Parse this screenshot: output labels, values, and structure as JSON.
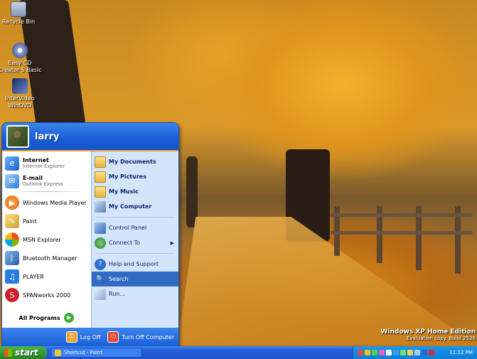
{
  "desktop": {
    "icons": [
      {
        "label": "Recycle Bin",
        "icon": "recycle-bin-icon"
      },
      {
        "label": "Easy CD Creator 5 Basic",
        "icon": "cd-icon"
      },
      {
        "label": "InterVideo WinDVD",
        "icon": "dvd-icon"
      }
    ],
    "watermark": {
      "line1": "Windows XP Home Edition",
      "line2": "Evaluation copy. Build 2526"
    }
  },
  "start_menu": {
    "user_name": "larry",
    "pinned": [
      {
        "title": "Internet",
        "subtitle": "Internet Explorer",
        "icon": "internet-explorer-icon"
      },
      {
        "title": "E-mail",
        "subtitle": "Outlook Express",
        "icon": "outlook-express-icon"
      }
    ],
    "recent": [
      {
        "label": "Windows Media Player",
        "icon": "media-player-icon"
      },
      {
        "label": "Paint",
        "icon": "paint-icon"
      },
      {
        "label": "MSN Explorer",
        "icon": "msn-icon"
      },
      {
        "label": "Bluetooth Manager",
        "icon": "bluetooth-icon"
      },
      {
        "label": "PLAYER",
        "icon": "music-note-icon"
      },
      {
        "label": "SPANworks 2000",
        "icon": "spanworks-icon"
      }
    ],
    "all_programs": "All Programs",
    "right": [
      {
        "label": "My Documents",
        "icon": "folder-icon"
      },
      {
        "label": "My Pictures",
        "icon": "folder-icon"
      },
      {
        "label": "My Music",
        "icon": "folder-icon"
      },
      {
        "label": "My Computer",
        "icon": "computer-icon"
      },
      {
        "label": "Control Panel",
        "icon": "control-panel-icon"
      },
      {
        "label": "Connect To",
        "icon": "connect-icon"
      },
      {
        "label": "Help and Support",
        "icon": "help-icon"
      },
      {
        "label": "Search",
        "icon": "search-icon"
      },
      {
        "label": "Run...",
        "icon": "run-icon"
      }
    ],
    "footer": {
      "log_off": "Log Off",
      "turn_off": "Turn Off Computer"
    }
  },
  "taskbar": {
    "start_label": "start",
    "tasks": [
      {
        "label": "Shortcut - Paint"
      }
    ],
    "clock": "11:12 PM"
  },
  "colors": {
    "highlight": "#316ac5",
    "start_green": "#339a2e",
    "taskbar_blue": "#245edb"
  }
}
